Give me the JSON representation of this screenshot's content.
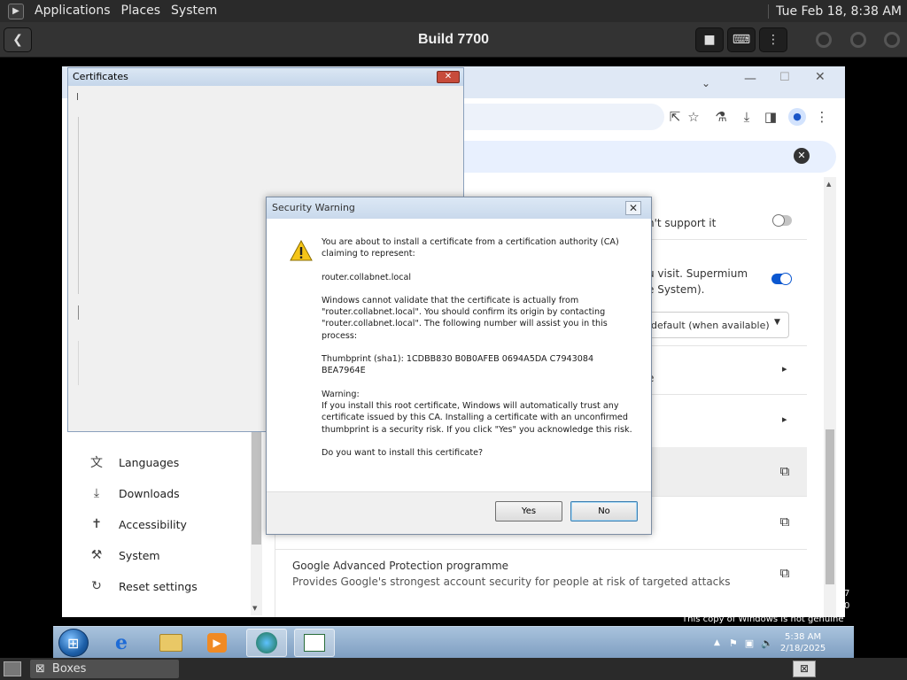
{
  "top_panel": {
    "menus": [
      "Applications",
      "Places",
      "System"
    ],
    "clock": "Tue Feb 18,  8:38 AM"
  },
  "boxes": {
    "title": "Build 7700",
    "back_icon": "arrow-left-icon",
    "buttons": [
      "stop-icon",
      "keyboard-icon",
      "kebab-menu-icon"
    ]
  },
  "chrome": {
    "toolbar_icons": [
      "share-icon",
      "star-icon",
      "extensions-icon",
      "download-icon",
      "sidepanel-icon",
      "profile-icon",
      "kebab-menu-icon"
    ],
    "settings_rows": [
      {
        "text": "n't support it",
        "control": "toggle-off"
      },
      {
        "text": "u visit. Supermium",
        "text2": "e System).",
        "control": "toggle-on"
      },
      {
        "text": "default (when available)",
        "control": "dropdown"
      },
      {
        "text": "e",
        "control": "chevron"
      },
      {
        "text": "",
        "control": "chevron"
      },
      {
        "text": "",
        "control": "external"
      },
      {
        "text": "",
        "control": "external"
      },
      {
        "text": "Google Advanced Protection programme",
        "text2": "Provides Google's strongest account security for people at risk of targeted attacks",
        "control": "external"
      }
    ],
    "sidebar": [
      {
        "label": "Languages",
        "icon": "translate-icon"
      },
      {
        "label": "Downloads",
        "icon": "download-icon"
      },
      {
        "label": "Accessibility",
        "icon": "accessibility-icon"
      },
      {
        "label": "System",
        "icon": "wrench-icon"
      },
      {
        "label": "Reset settings",
        "icon": "reset-icon"
      }
    ]
  },
  "certificates": {
    "title": "Certificates"
  },
  "security_warning": {
    "title": "Security Warning",
    "p1": "You are about to install a certificate from a certification authority (CA) claiming to represent:",
    "p2": "router.collabnet.local",
    "p3": "Windows cannot validate that the certificate is actually from \"router.collabnet.local\". You should confirm its origin by contacting \"router.collabnet.local\". The following number will assist you in this process:",
    "p4": "Thumbprint (sha1): 1CDBB830 B0B0AFEB 0694A5DA C7943084 BEA7964E",
    "p5a": "Warning:",
    "p5b": "If you install this root certificate, Windows will automatically trust any certificate issued by this CA. Installing a certificate with an unconfirmed thumbprint is a security risk. If you click \"Yes\" you acknowledge this risk.",
    "p6": "Do you want to install this certificate?",
    "yes": "Yes",
    "no": "No"
  },
  "windows": {
    "tray_time": "5:38 AM",
    "tray_date": "2/18/2025",
    "genuine": "This copy of Windows is not genuine",
    "side_digits": [
      "7",
      "0"
    ]
  },
  "bottom_panel": {
    "task": "Boxes"
  }
}
